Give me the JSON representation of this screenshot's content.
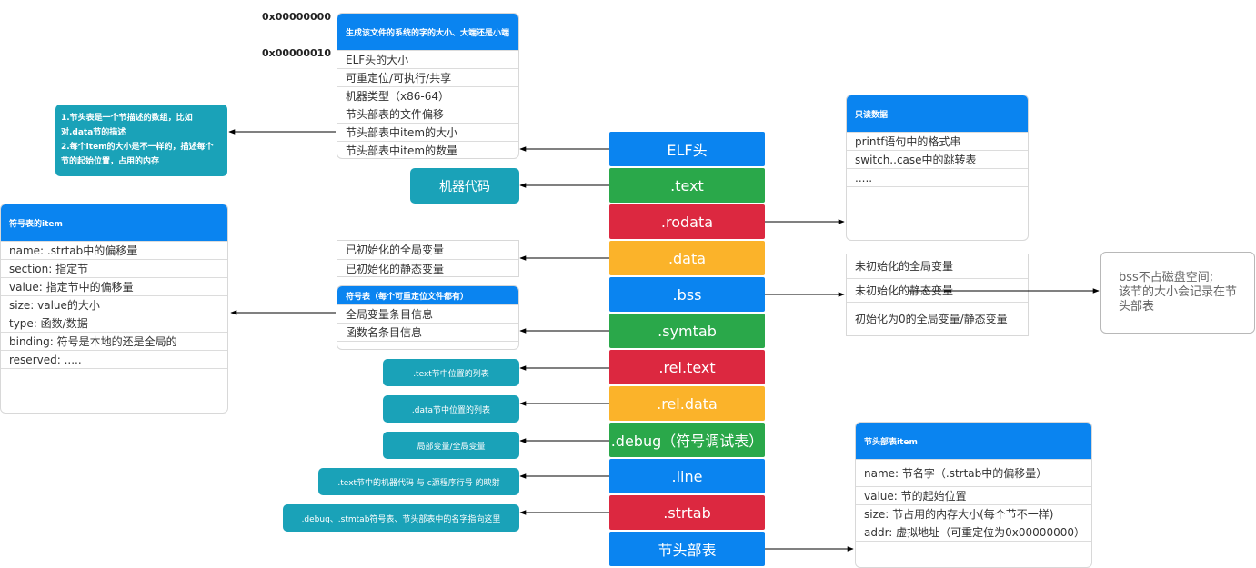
{
  "addresses": [
    "0x00000000",
    "0x00000010"
  ],
  "elf_sections": [
    {
      "label": "ELF头",
      "color": "#0a84f0"
    },
    {
      "label": ".text",
      "color": "#2aa84a"
    },
    {
      "label": ".rodata",
      "color": "#dc2840"
    },
    {
      "label": ".data",
      "color": "#fbb32a"
    },
    {
      "label": ".bss",
      "color": "#0a84f0"
    },
    {
      "label": ".symtab",
      "color": "#2aa84a"
    },
    {
      "label": ".rel.text",
      "color": "#dc2840"
    },
    {
      "label": ".rel.data",
      "color": "#fbb32a"
    },
    {
      "label": ".debug（符号调试表）",
      "color": "#2aa84a"
    },
    {
      "label": ".line",
      "color": "#0a84f0"
    },
    {
      "label": ".strtab",
      "color": "#dc2840"
    },
    {
      "label": "节头部表",
      "color": "#0a84f0"
    }
  ],
  "elf_header_card": {
    "title": "生成该文件的系统的字的大小、大端还是小端",
    "rows": [
      "ELF头的大小",
      "可重定位/可执行/共享",
      "机器类型（x86-64）",
      "节头部表的文件偏移",
      "节头部表中item的大小",
      "节头部表中item的数量"
    ]
  },
  "section_header_note": {
    "lines": [
      "1.节头表是一个节描述的数组，比如",
      "对.data节的描述",
      "2.每个item的大小是不一样的，描述每个",
      "节的起始位置，占用的内存"
    ]
  },
  "machine_code_note": "机器代码",
  "data_card": {
    "rows": [
      "已初始化的全局变量",
      "已初始化的静态变量"
    ]
  },
  "symtab_card": {
    "title": "符号表（每个可重定位文件都有）",
    "rows": [
      "全局变量条目信息",
      "函数名条目信息"
    ]
  },
  "symbol_item_card": {
    "title": "符号表的item",
    "rows": [
      "name: .strtab中的偏移量",
      "section: 指定节",
      "value: 指定节中的偏移量",
      "size: value的大小",
      "type: 函数/数据",
      "binding: 符号是本地的还是全局的",
      "reserved: ....."
    ]
  },
  "rodata_card": {
    "title": "只读数据",
    "rows": [
      "printf语句中的格式串",
      "switch..case中的跳转表",
      "....."
    ]
  },
  "bss_card": {
    "rows": [
      "未初始化的全局变量",
      "未初始化的静态变量",
      "初始化为0的全局变量/静态变量"
    ]
  },
  "bss_note": {
    "lines": [
      "bss不占磁盘空间;",
      "该节的大小会记录在节",
      "头部表"
    ]
  },
  "small_notes": {
    "rel_text": ".text节中位置的列表",
    "rel_data": ".data节中位置的列表",
    "debug": "局部变量/全局变量",
    "line": ".text节中的机器代码 与 c源程序行号 的映射",
    "strtab": ".debug、.stmtab符号表、节头部表中的名字指向这里"
  },
  "section_item_card": {
    "title": "节头部表item",
    "rows": [
      "name: 节名字（.strtab中的偏移量）",
      "value: 节的起始位置",
      "size: 节占用的内存大小(每个节不一样)",
      "addr: 虚拟地址（可重定位为0x00000000）"
    ]
  }
}
